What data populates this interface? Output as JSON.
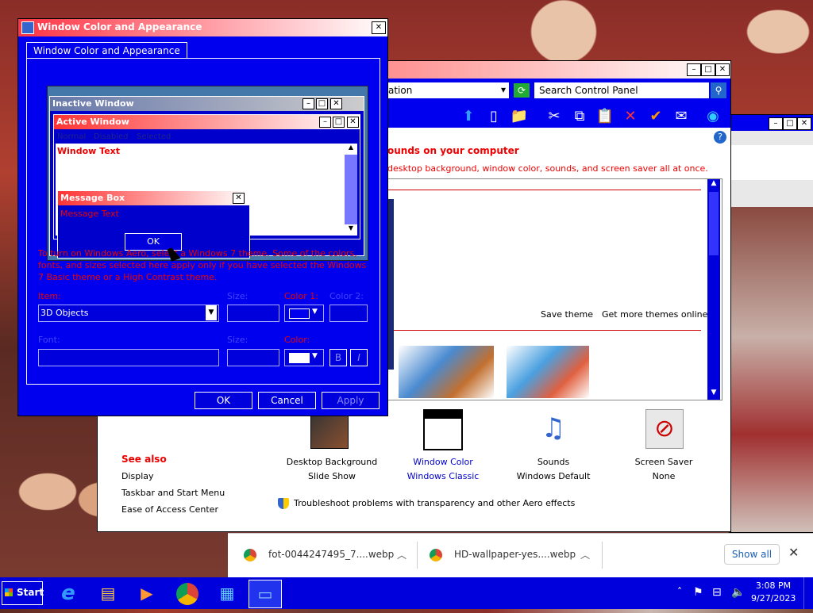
{
  "dialog": {
    "title": "Window Color and Appearance",
    "tab": "Window Color and Appearance",
    "preview": {
      "inactive_window": "Inactive Window",
      "active_window": "Active Window",
      "menu_normal": "Normal",
      "menu_disabled": "Disabled",
      "menu_selected": "Selected",
      "window_text": "Window Text",
      "message_box_title": "Message Box",
      "message_text": "Message Text",
      "ok": "OK"
    },
    "info_text": "To turn on Windows Aero, select a Windows 7 theme.  Some of the colors, fonts, and sizes selected here apply only if you have selected the Windows 7 Basic theme or a High Contrast theme.",
    "item_label": "Item:",
    "item_value": "3D Objects",
    "size_label": "Size:",
    "color1_label": "Color 1:",
    "color2_label": "Color 2:",
    "font_label": "Font:",
    "size2_label": "Size:",
    "color_label": "Color:",
    "bold": "B",
    "italic": "I",
    "ok_btn": "OK",
    "cancel_btn": "Cancel",
    "apply_btn": "Apply"
  },
  "control_panel": {
    "address_fragment": "ation",
    "search_placeholder": "Search Control Panel",
    "heading": "ounds on your computer",
    "subtext": "desktop background, window color, sounds, and screen saver all at once.",
    "save_theme": "Save theme",
    "get_more_themes": "Get more themes online",
    "see_also": "See also",
    "links": [
      "Display",
      "Taskbar and Start Menu",
      "Ease of Access Center"
    ],
    "items": [
      {
        "label": "Desktop Background",
        "sub": "Slide Show"
      },
      {
        "label": "Window Color",
        "sub": "Windows Classic"
      },
      {
        "label": "Sounds",
        "sub": "Windows Default"
      },
      {
        "label": "Screen Saver",
        "sub": "None"
      }
    ],
    "troubleshoot": "Troubleshoot problems with transparency and other Aero effects"
  },
  "downloads": [
    {
      "name": "fot-0044247495_7....webp"
    },
    {
      "name": "HD-wallpaper-yes....webp"
    }
  ],
  "show_all": "Show all",
  "taskbar": {
    "start": "Start",
    "time": "3:08 PM",
    "date": "9/27/2023"
  }
}
